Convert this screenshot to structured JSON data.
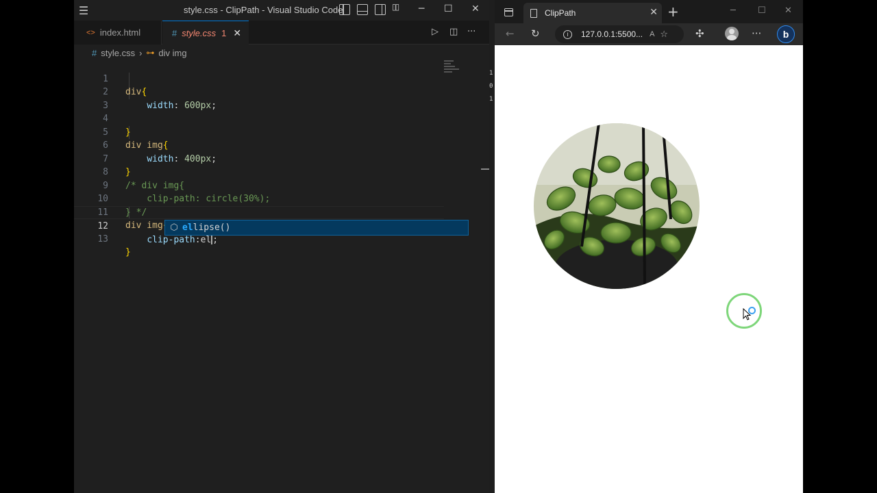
{
  "vscode": {
    "window_title": "style.css - ClipPath - Visual Studio Code",
    "tabs": [
      {
        "label": "index.html",
        "icon": "html-icon"
      },
      {
        "label": "style.css",
        "icon": "css-icon",
        "badge": "1",
        "active": true
      }
    ],
    "breadcrumb": {
      "file": "style.css",
      "symbol": "div img"
    },
    "lines": [
      {
        "n": "1",
        "sel": "div",
        "open": "{"
      },
      {
        "n": "2",
        "prop": "width",
        "value": "600px"
      },
      {
        "n": "3"
      },
      {
        "n": "4",
        "close": "}"
      },
      {
        "n": "5",
        "sel": "div img",
        "open": "{"
      },
      {
        "n": "6",
        "prop": "width",
        "value": "400px"
      },
      {
        "n": "7",
        "close": "}"
      },
      {
        "n": "8",
        "comment": "/* div img{"
      },
      {
        "n": "9",
        "comment": "    clip-path: circle(30%);"
      },
      {
        "n": "10",
        "comment": "} */"
      },
      {
        "n": "11",
        "sel": "div img",
        "open": "{"
      },
      {
        "n": "12",
        "prop": "clip-path",
        "typed": "el"
      },
      {
        "n": "13",
        "close": "}"
      }
    ],
    "suggestion": {
      "match": "el",
      "rest": "lipse()",
      "icon": "cube-icon"
    },
    "right_edge_digits": [
      "1",
      "0",
      "1"
    ]
  },
  "browser": {
    "tab_title": "ClipPath",
    "url": "127.0.0.1:5500...",
    "read_aloud": "A",
    "icons": [
      "back-icon",
      "refresh-icon",
      "info-icon",
      "read-aloud-icon",
      "favorites-icon",
      "extensions-icon",
      "profile-icon",
      "more-icon",
      "copilot-icon"
    ]
  },
  "colors": {
    "editor_bg": "#1f1f1f",
    "accent": "#0078d4",
    "suggest_bg": "#04395e",
    "cursor_ring": "#7ed67a"
  }
}
